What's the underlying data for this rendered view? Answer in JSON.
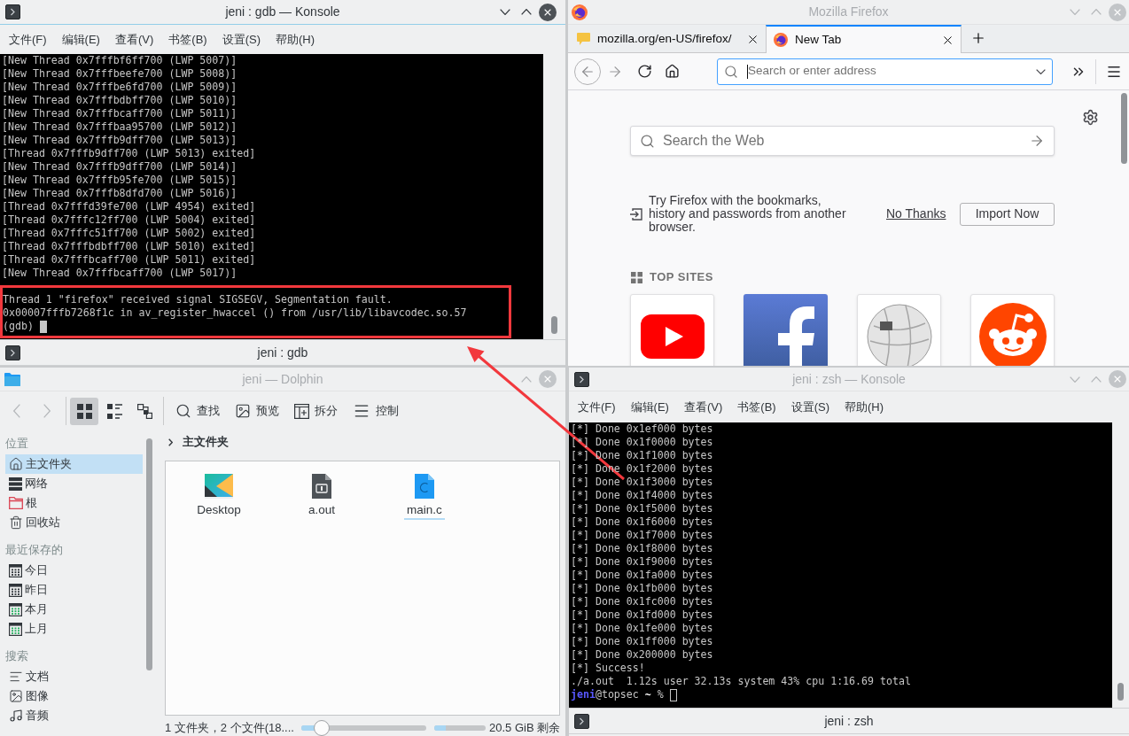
{
  "gdb_konsole": {
    "title": "jeni : gdb — Konsole",
    "focused": true,
    "menu": [
      "文件(F)",
      "编辑(E)",
      "查看(V)",
      "书签(B)",
      "设置(S)",
      "帮助(H)"
    ],
    "output": [
      "[New Thread 0x7fffbf6ff700 (LWP 5007)]",
      "[New Thread 0x7fffbeefe700 (LWP 5008)]",
      "[New Thread 0x7fffbe6fd700 (LWP 5009)]",
      "[New Thread 0x7fffbdbff700 (LWP 5010)]",
      "[New Thread 0x7fffbcaff700 (LWP 5011)]",
      "[New Thread 0x7fffbaa95700 (LWP 5012)]",
      "[New Thread 0x7fffb9dff700 (LWP 5013)]",
      "[Thread 0x7fffb9dff700 (LWP 5013) exited]",
      "[New Thread 0x7fffb9dff700 (LWP 5014)]",
      "[New Thread 0x7fffb95fe700 (LWP 5015)]",
      "[New Thread 0x7fffb8dfd700 (LWP 5016)]",
      "[Thread 0x7fffd39fe700 (LWP 4954) exited]",
      "[Thread 0x7fffc12ff700 (LWP 5004) exited]",
      "[Thread 0x7fffc51ff700 (LWP 5002) exited]",
      "[Thread 0x7fffbdbff700 (LWP 5010) exited]",
      "[Thread 0x7fffbcaff700 (LWP 5011) exited]",
      "[New Thread 0x7fffbcaff700 (LWP 5017)]"
    ],
    "highlighted_output": [
      "Thread 1 \"firefox\" received signal SIGSEGV, Segmentation fault.",
      "0x00007fffb7268f1c in av_register_hwaccel () from /usr/lib/libavcodec.so.57"
    ],
    "prompt": "(gdb)",
    "session_tab": "jeni : gdb"
  },
  "firefox": {
    "title": "Mozilla Firefox",
    "focused": false,
    "tabs": [
      {
        "label": "mozilla.org/en-US/firefox/",
        "selected": false
      },
      {
        "label": "New Tab",
        "selected": true
      }
    ],
    "address_bar": {
      "placeholder": "Search or enter address"
    },
    "web_search": {
      "placeholder": "Search the Web"
    },
    "import_notice": {
      "message": "Try Firefox with the bookmarks, history and passwords from another browser.",
      "dismiss_link": "No Thanks",
      "import_button": "Import Now"
    },
    "top_sites": {
      "heading": "TOP SITES"
    }
  },
  "dolphin": {
    "title": "jeni — Dolphin",
    "focused": false,
    "view_modes": [
      {
        "selected": true
      },
      {
        "selected": false
      },
      {
        "selected": false
      }
    ],
    "toolbar": [
      "查找",
      "预览",
      "拆分",
      "控制"
    ],
    "places": [
      {
        "heading": "位置",
        "items": [
          {
            "label": "主文件夹",
            "selected": true
          },
          {
            "label": "网络",
            "selected": false
          },
          {
            "label": "根",
            "selected": false
          },
          {
            "label": "回收站",
            "selected": false
          }
        ]
      },
      {
        "heading": "最近保存的",
        "items": [
          {
            "label": "今日",
            "selected": false
          },
          {
            "label": "昨日",
            "selected": false
          },
          {
            "label": "本月",
            "selected": false
          },
          {
            "label": "上月",
            "selected": false
          }
        ]
      },
      {
        "heading": "搜索",
        "items": [
          {
            "label": "文档",
            "selected": false
          },
          {
            "label": "图像",
            "selected": false
          },
          {
            "label": "音频",
            "selected": false
          }
        ]
      }
    ],
    "breadcrumb": "主文件夹",
    "files": [
      {
        "name": "Desktop",
        "hovered": false
      },
      {
        "name": "a.out",
        "hovered": false
      },
      {
        "name": "main.c",
        "hovered": true
      }
    ],
    "status": {
      "summary": "1 文件夹，2 个文件(18....",
      "zoom": {
        "level": 0.16
      },
      "free_space": {
        "level": 0.22,
        "label": "20.5 GiB 剩余"
      }
    }
  },
  "zsh_konsole": {
    "title": "jeni : zsh — Konsole",
    "focused": false,
    "menu": [
      "文件(F)",
      "编辑(E)",
      "查看(V)",
      "书签(B)",
      "设置(S)",
      "帮助(H)"
    ],
    "output": [
      "[*] Done 0x1ef000 bytes",
      "[*] Done 0x1f0000 bytes",
      "[*] Done 0x1f1000 bytes",
      "[*] Done 0x1f2000 bytes",
      "[*] Done 0x1f3000 bytes",
      "[*] Done 0x1f4000 bytes",
      "[*] Done 0x1f5000 bytes",
      "[*] Done 0x1f6000 bytes",
      "[*] Done 0x1f7000 bytes",
      "[*] Done 0x1f8000 bytes",
      "[*] Done 0x1f9000 bytes",
      "[*] Done 0x1fa000 bytes",
      "[*] Done 0x1fb000 bytes",
      "[*] Done 0x1fc000 bytes",
      "[*] Done 0x1fd000 bytes",
      "[*] Done 0x1fe000 bytes",
      "[*] Done 0x1ff000 bytes",
      "[*] Done 0x200000 bytes",
      "[*] Success!",
      "./a.out  1.12s user 32.13s system 43% cpu 1:16.69 total"
    ],
    "prompt": {
      "user": "jeni",
      "host": "@topsec",
      "directory": "~",
      "symbol": "%"
    },
    "session_tab": "jeni : zsh"
  }
}
